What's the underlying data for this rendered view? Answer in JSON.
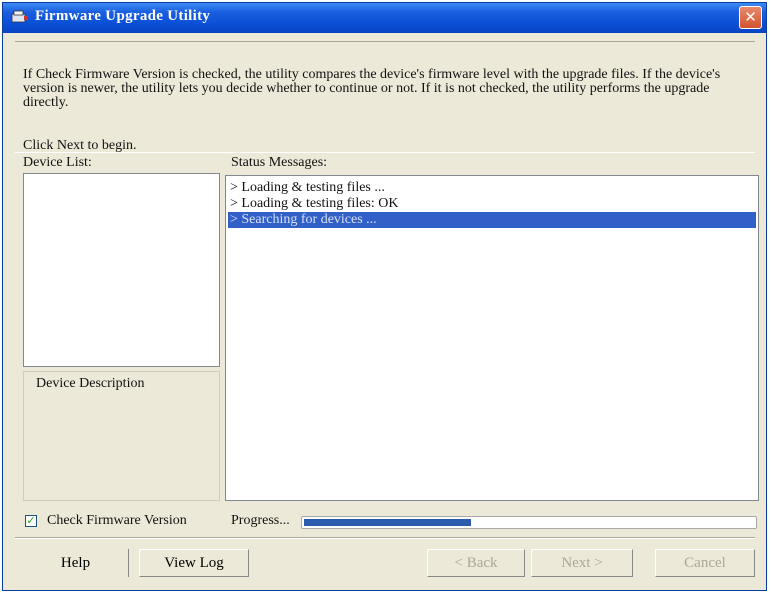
{
  "window": {
    "title": "Firmware Upgrade Utility",
    "close_label": "✕"
  },
  "intro": {
    "text": "If Check Firmware Version is checked, the utility compares the device's firmware level with the upgrade files. If the device's version is newer, the utility lets you decide whether to continue or not. If it is not checked, the utility performs the upgrade directly.",
    "begin": "Click Next to begin."
  },
  "device_list": {
    "label": "Device List:",
    "items": []
  },
  "device_description": {
    "label": "Device Description"
  },
  "status": {
    "label": "Status Messages:",
    "messages": [
      "> Loading & testing files ...",
      "> Loading & testing files: OK",
      "> Searching for devices ..."
    ],
    "selected_index": 2
  },
  "check_firmware": {
    "label": "Check Firmware Version",
    "checked": true,
    "check_glyph": "✓"
  },
  "progress": {
    "label": "Progress...",
    "fraction": 0.37
  },
  "buttons": {
    "help": "Help",
    "view_log": "View Log",
    "back": "< Back",
    "next": "Next >",
    "cancel": "Cancel"
  },
  "colors": {
    "titlebar": "#0a4fd6",
    "selection": "#3160c8",
    "progress_fill": "#2c5cae"
  },
  "icons": {
    "app": "app-icon",
    "close": "close-icon"
  }
}
